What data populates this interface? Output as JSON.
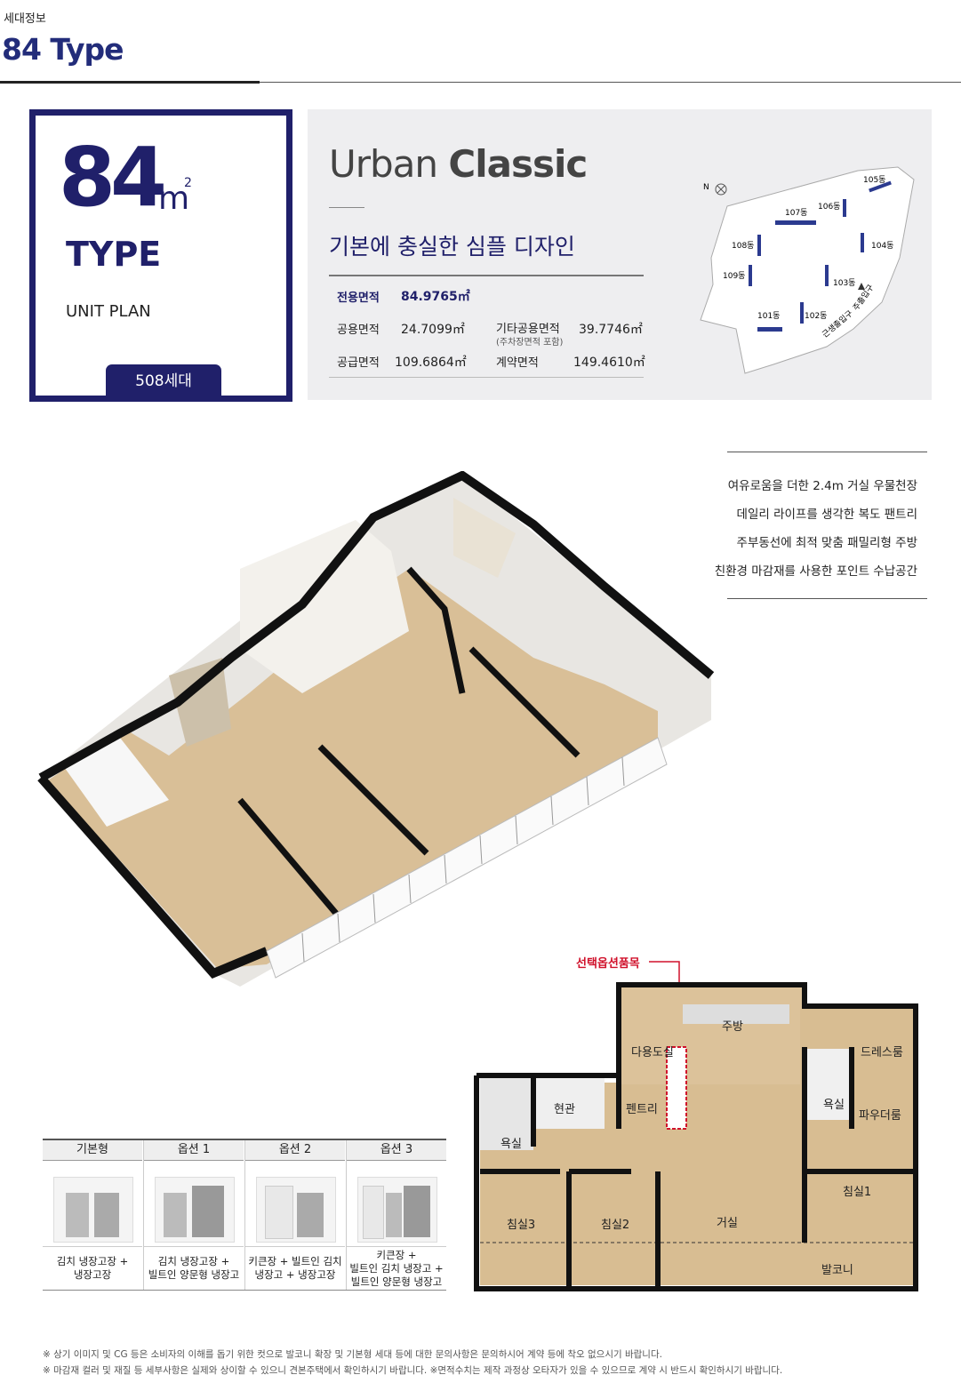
{
  "header": {
    "section": "세대정보",
    "title": "84 Type"
  },
  "type_box": {
    "size_number": "84",
    "size_unit": "m",
    "size_sup": "2",
    "type_label": "TYPE",
    "unit_plan": "UNIT PLAN",
    "households": "508세대"
  },
  "concept": {
    "title_light": "Urban ",
    "title_bold": "Classic",
    "tagline": "기본에 충실한 심플 디자인"
  },
  "areas": {
    "exclusive_label": "전용면적",
    "exclusive_value": "84.9765㎡",
    "common_label": "공용면적",
    "common_value": "24.7099㎡",
    "other_common_label": "기타공용면적",
    "other_common_note": "(주차장면적 포함)",
    "other_common_value": "39.7746㎡",
    "supply_label": "공급면적",
    "supply_value": "109.6864㎡",
    "contract_label": "계약면적",
    "contract_value": "149.4610㎡"
  },
  "site_map": {
    "north": "N",
    "buildings": [
      "105동",
      "106동",
      "107동",
      "108동",
      "104동",
      "109동",
      "103동",
      "101동",
      "102동"
    ],
    "entrances": [
      "근생출입구",
      "주출입구"
    ]
  },
  "features": [
    "여유로움을 더한 2.4m 거실 우물천장",
    "데일리 라이프를 생각한 복도 팬트리",
    "주부동선에 최적 맞춤 패밀리형 주방",
    "친환경 마감재를 사용한 포인트 수납공간"
  ],
  "floorplan": {
    "option_callout": "선택옵션품목",
    "rooms": [
      "다용도실",
      "주방",
      "드레스룸",
      "현관",
      "펜트리",
      "욕실",
      "욕실",
      "파우더룸",
      "침실3",
      "침실2",
      "거실",
      "침실1",
      "발코니"
    ]
  },
  "options_table": {
    "headers": [
      "기본형",
      "옵션 1",
      "옵션 2",
      "옵션 3"
    ],
    "captions": [
      "김치 냉장고장 +\n냉장고장",
      "김치 냉장고장 +\n빌트인 양문형 냉장고",
      "키큰장 + 빌트인 김치\n냉장고 + 냉장고장",
      "키큰장 +\n빌트인 김치 냉장고 +\n빌트인 양문형 냉장고"
    ]
  },
  "footnotes": [
    "※ 상기 이미지 및 CG 등은 소비자의 이해를 돕기 위한 컷으로 발코니 확장 및 기본형 세대 등에 대한 문의사항은 문의하시어 계약 등에 착오 없으시기 바랍니다.",
    "※ 마감재 컬러 및 재질 등 세부사항은 실제와 상이할 수 있으니 견본주택에서 확인하시기 바랍니다. ※면적수치는 제작 과정상 오타자가 있을 수 있으므로 계약 시 반드시 확인하시기 바랍니다."
  ],
  "colors": {
    "navy": "#20206a",
    "callout_red": "#d0112b",
    "wood": "#d9bf97",
    "wall": "#111111",
    "panel_gray": "#eeeef0"
  }
}
